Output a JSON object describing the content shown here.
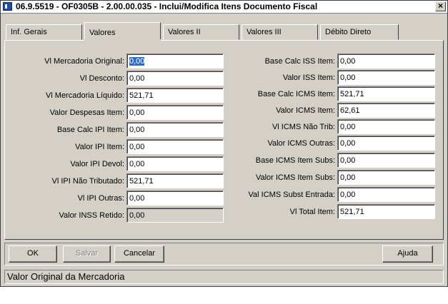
{
  "window": {
    "title": "06.9.5519 - OF0305B - 2.00.00.035 - Inclui/Modifica Itens Documento Fiscal",
    "close_glyph": "×"
  },
  "tabs": [
    {
      "label": "Inf. Gerais"
    },
    {
      "label": "Valores"
    },
    {
      "label": "Valores II"
    },
    {
      "label": "Valores III"
    },
    {
      "label": "Débito Direto"
    }
  ],
  "left_fields": [
    {
      "label": "Vl Mercadoria Original:",
      "value": "0,00",
      "selected": true
    },
    {
      "label": "Vl Desconto:",
      "value": "0,00"
    },
    {
      "label": "Vl Mercadoria Líquido:",
      "value": "521,71"
    },
    {
      "label": "Valor Despesas Item:",
      "value": "0,00"
    },
    {
      "label": "Base Calc IPI Item:",
      "value": "0,00"
    },
    {
      "label": "Valor IPI Item:",
      "value": "0,00"
    },
    {
      "label": "Valor IPI Devol:",
      "value": "0,00"
    },
    {
      "label": "Vl IPI Não Tributado:",
      "value": "521,71"
    },
    {
      "label": "Vl IPI Outras:",
      "value": "0,00"
    },
    {
      "label": "Valor INSS Retido:",
      "value": "0,00",
      "disabled": true
    }
  ],
  "right_fields": [
    {
      "label": "Base Calc ISS Item:",
      "value": "0,00"
    },
    {
      "label": "Valor ISS Item:",
      "value": "0,00"
    },
    {
      "label": "Base Calc ICMS Item:",
      "value": "521,71"
    },
    {
      "label": "Valor ICMS Item:",
      "value": "62,61"
    },
    {
      "label": "Vl ICMS Não Trib:",
      "value": "0,00"
    },
    {
      "label": "Valor ICMS Outras:",
      "value": "0,00"
    },
    {
      "label": "Base ICMS Item Subs:",
      "value": "0,00"
    },
    {
      "label": "Valor ICMS Item Subs:",
      "value": "0,00"
    },
    {
      "label": "Val ICMS Subst Entrada:",
      "value": "0,00"
    },
    {
      "label": "Vl Total Item:",
      "value": "521,71"
    }
  ],
  "buttons": {
    "ok": "OK",
    "salvar": "Salvar",
    "cancelar": "Cancelar",
    "ajuda": "Ajuda"
  },
  "status": {
    "text": "Valor Original da Mercadoria"
  }
}
